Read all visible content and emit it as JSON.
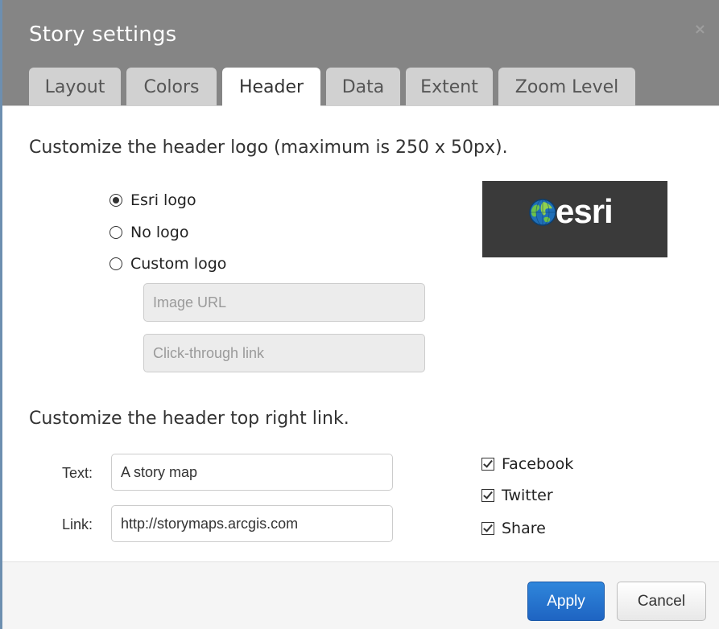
{
  "dialog": {
    "title": "Story settings",
    "close_icon": "×"
  },
  "tabs": [
    {
      "label": "Layout"
    },
    {
      "label": "Colors"
    },
    {
      "label": "Header",
      "active": true
    },
    {
      "label": "Data"
    },
    {
      "label": "Extent"
    },
    {
      "label": "Zoom Level"
    }
  ],
  "logo_section": {
    "heading": "Customize the header logo (maximum is 250 x 50px).",
    "options": [
      {
        "label": "Esri logo",
        "checked": true
      },
      {
        "label": "No logo",
        "checked": false
      },
      {
        "label": "Custom logo",
        "checked": false
      }
    ],
    "image_url_placeholder": "Image URL",
    "click_through_placeholder": "Click-through link",
    "preview_text": "esri"
  },
  "link_section": {
    "heading": "Customize the header top right link.",
    "text_label": "Text:",
    "text_value": "A story map",
    "link_label": "Link:",
    "link_value": "http://storymaps.arcgis.com",
    "social": [
      {
        "label": "Facebook",
        "checked": true
      },
      {
        "label": "Twitter",
        "checked": true
      },
      {
        "label": "Share",
        "checked": true
      }
    ]
  },
  "footer": {
    "apply_label": "Apply",
    "cancel_label": "Cancel"
  },
  "colors": {
    "titlebar": "#858585",
    "tab_inactive": "#d1d1d1",
    "apply_blue": "#2a7fd4"
  }
}
